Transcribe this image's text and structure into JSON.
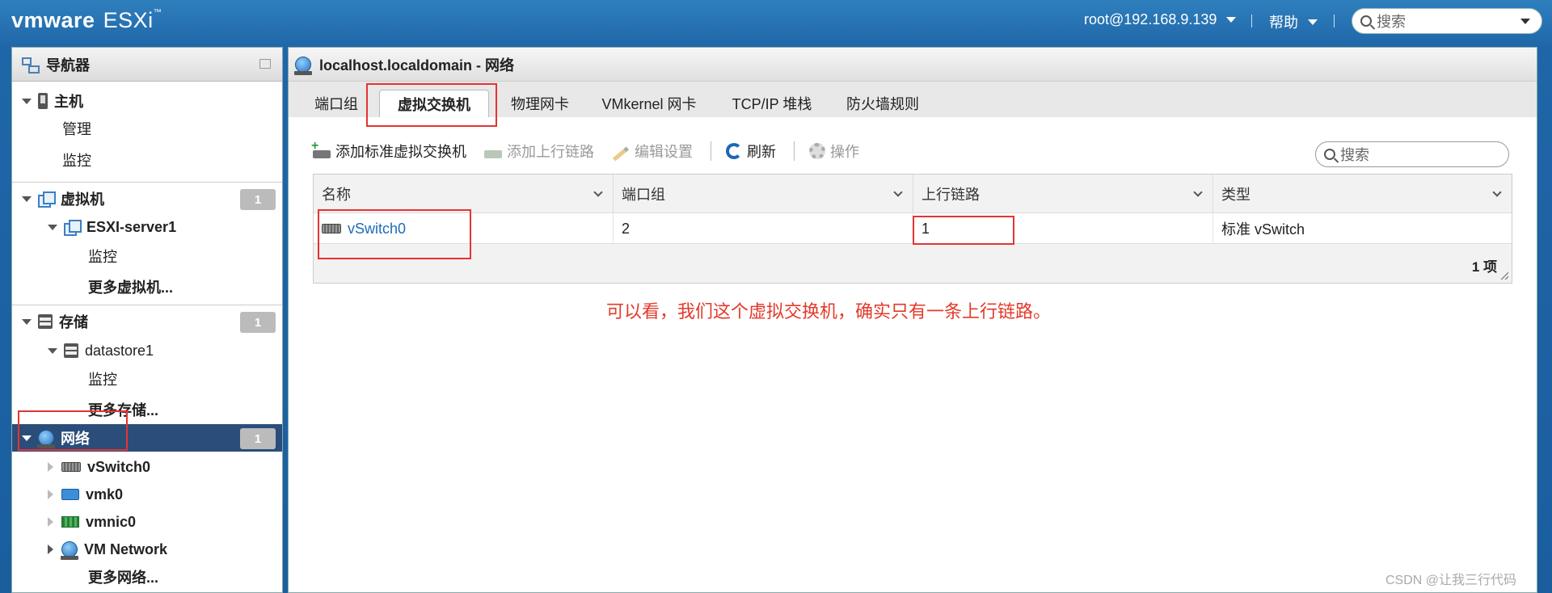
{
  "topbar": {
    "logo_vm": "vmware",
    "logo_product": "ESXi",
    "user": "root@192.168.9.139",
    "help": "帮助",
    "search_placeholder": "搜索"
  },
  "navigator": {
    "title": "导航器",
    "items": [
      {
        "label": "主机",
        "icon": "host-icon"
      },
      {
        "label": "管理"
      },
      {
        "label": "监控"
      },
      {
        "label": "虚拟机",
        "badge": "1",
        "icon": "vm-icon"
      },
      {
        "label": "ESXI-server1",
        "icon": "vm-icon"
      },
      {
        "label": "监控"
      },
      {
        "label": "更多虚拟机..."
      },
      {
        "label": "存储",
        "badge": "1",
        "icon": "datastore-icon"
      },
      {
        "label": "datastore1",
        "icon": "datastore-icon"
      },
      {
        "label": "监控"
      },
      {
        "label": "更多存储..."
      },
      {
        "label": "网络",
        "badge": "1",
        "icon": "network-globe-icon"
      },
      {
        "label": "vSwitch0",
        "icon": "switch-icon"
      },
      {
        "label": "vmk0",
        "icon": "vmkernel-nic-icon"
      },
      {
        "label": "vmnic0",
        "icon": "physical-nic-icon"
      },
      {
        "label": "VM Network",
        "icon": "network-globe-icon"
      },
      {
        "label": "更多网络..."
      }
    ]
  },
  "main": {
    "title": "localhost.localdomain - 网络",
    "tabs": [
      "端口组",
      "虚拟交换机",
      "物理网卡",
      "VMkernel 网卡",
      "TCP/IP 堆栈",
      "防火墙规则"
    ],
    "active_tab": "虚拟交换机",
    "toolbar": {
      "add_switch": "添加标准虚拟交换机",
      "add_uplink": "添加上行链路",
      "edit_settings": "编辑设置",
      "refresh": "刷新",
      "actions": "操作"
    },
    "search_placeholder": "搜索",
    "table": {
      "columns": [
        "名称",
        "端口组",
        "上行链路",
        "类型"
      ],
      "rows": [
        {
          "name": "vSwitch0",
          "port_groups": "2",
          "uplinks": "1",
          "type": "标准 vSwitch"
        }
      ],
      "footer": "1 项"
    },
    "annotation": "可以看，我们这个虚拟交换机，确实只有一条上行链路。"
  },
  "watermark": "CSDN @让我三行代码",
  "colors": {
    "accent_red": "#e53333",
    "selected_bg": "#2b4d7a",
    "link": "#1e6bb8"
  }
}
